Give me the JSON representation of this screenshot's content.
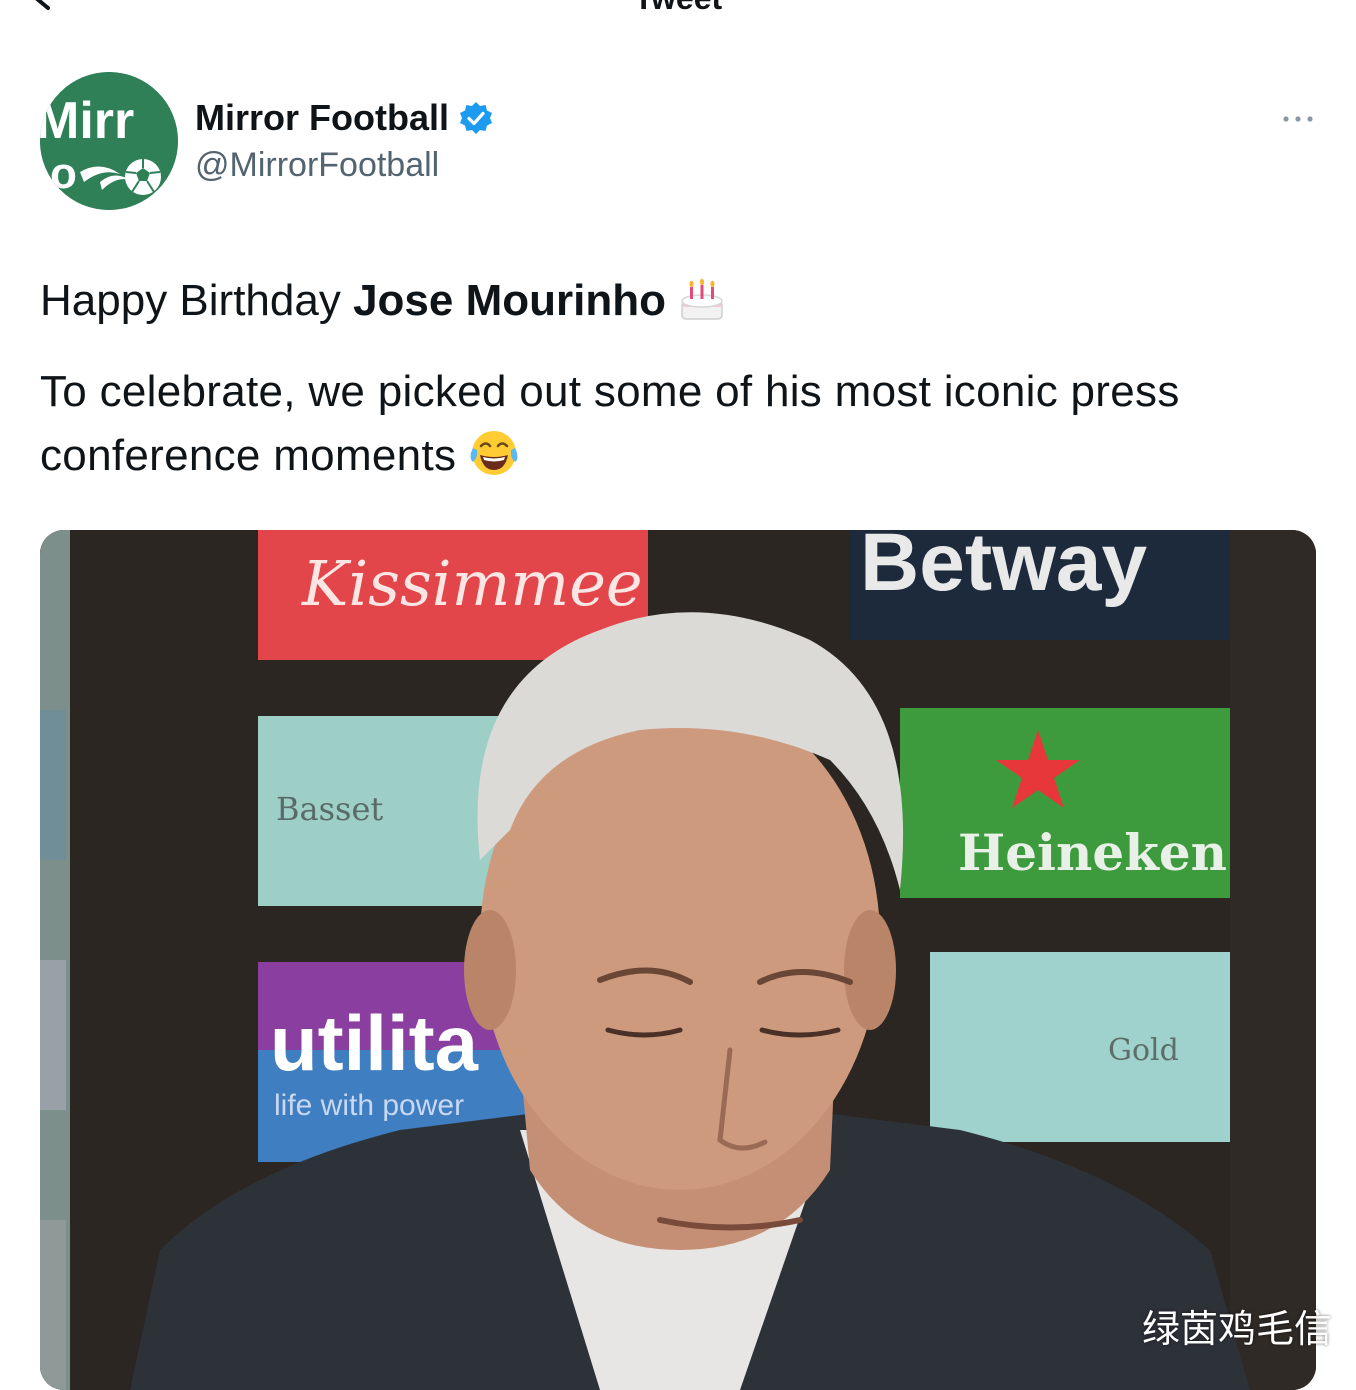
{
  "nav": {
    "title": "Tweet"
  },
  "tweet": {
    "author": {
      "display_name": "Mirror Football",
      "handle": "@MirrorFootball",
      "verified": true,
      "avatar_text": "Mirror"
    },
    "text": {
      "line1_prefix": "Happy Birthday ",
      "line1_bold": "Jose Mourinho",
      "line1_emoji": "birthday-cake",
      "line2": "To celebrate, we picked out some of his most iconic press conference moments",
      "line2_emoji": "laughing-tears"
    },
    "media": {
      "sponsors": [
        "Kissimmee",
        "Betway",
        "Basset",
        "Heineken",
        "utilita",
        "life with power",
        "Gold"
      ]
    }
  },
  "watermark": "绿茵鸡毛信",
  "colors": {
    "verified_blue": "#1d9bf0",
    "avatar_green": "#2f7f57",
    "handle_gray": "#536471"
  }
}
